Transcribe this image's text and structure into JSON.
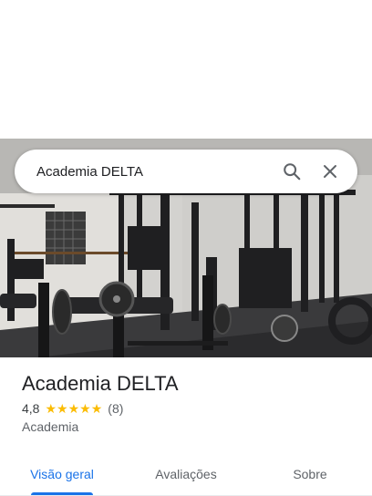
{
  "search": {
    "query": "Academia DELTA"
  },
  "place": {
    "title": "Academia DELTA",
    "rating_value": "4,8",
    "stars": 5,
    "review_count": "(8)",
    "category": "Academia"
  },
  "tabs": [
    {
      "label": "Visão geral",
      "active": true
    },
    {
      "label": "Avaliações",
      "active": false
    },
    {
      "label": "Sobre",
      "active": false
    }
  ],
  "colors": {
    "accent": "#1a73e8",
    "star": "#fbbc04"
  },
  "icons": {
    "search": "search-icon",
    "close": "close-icon",
    "star": "star-icon"
  }
}
